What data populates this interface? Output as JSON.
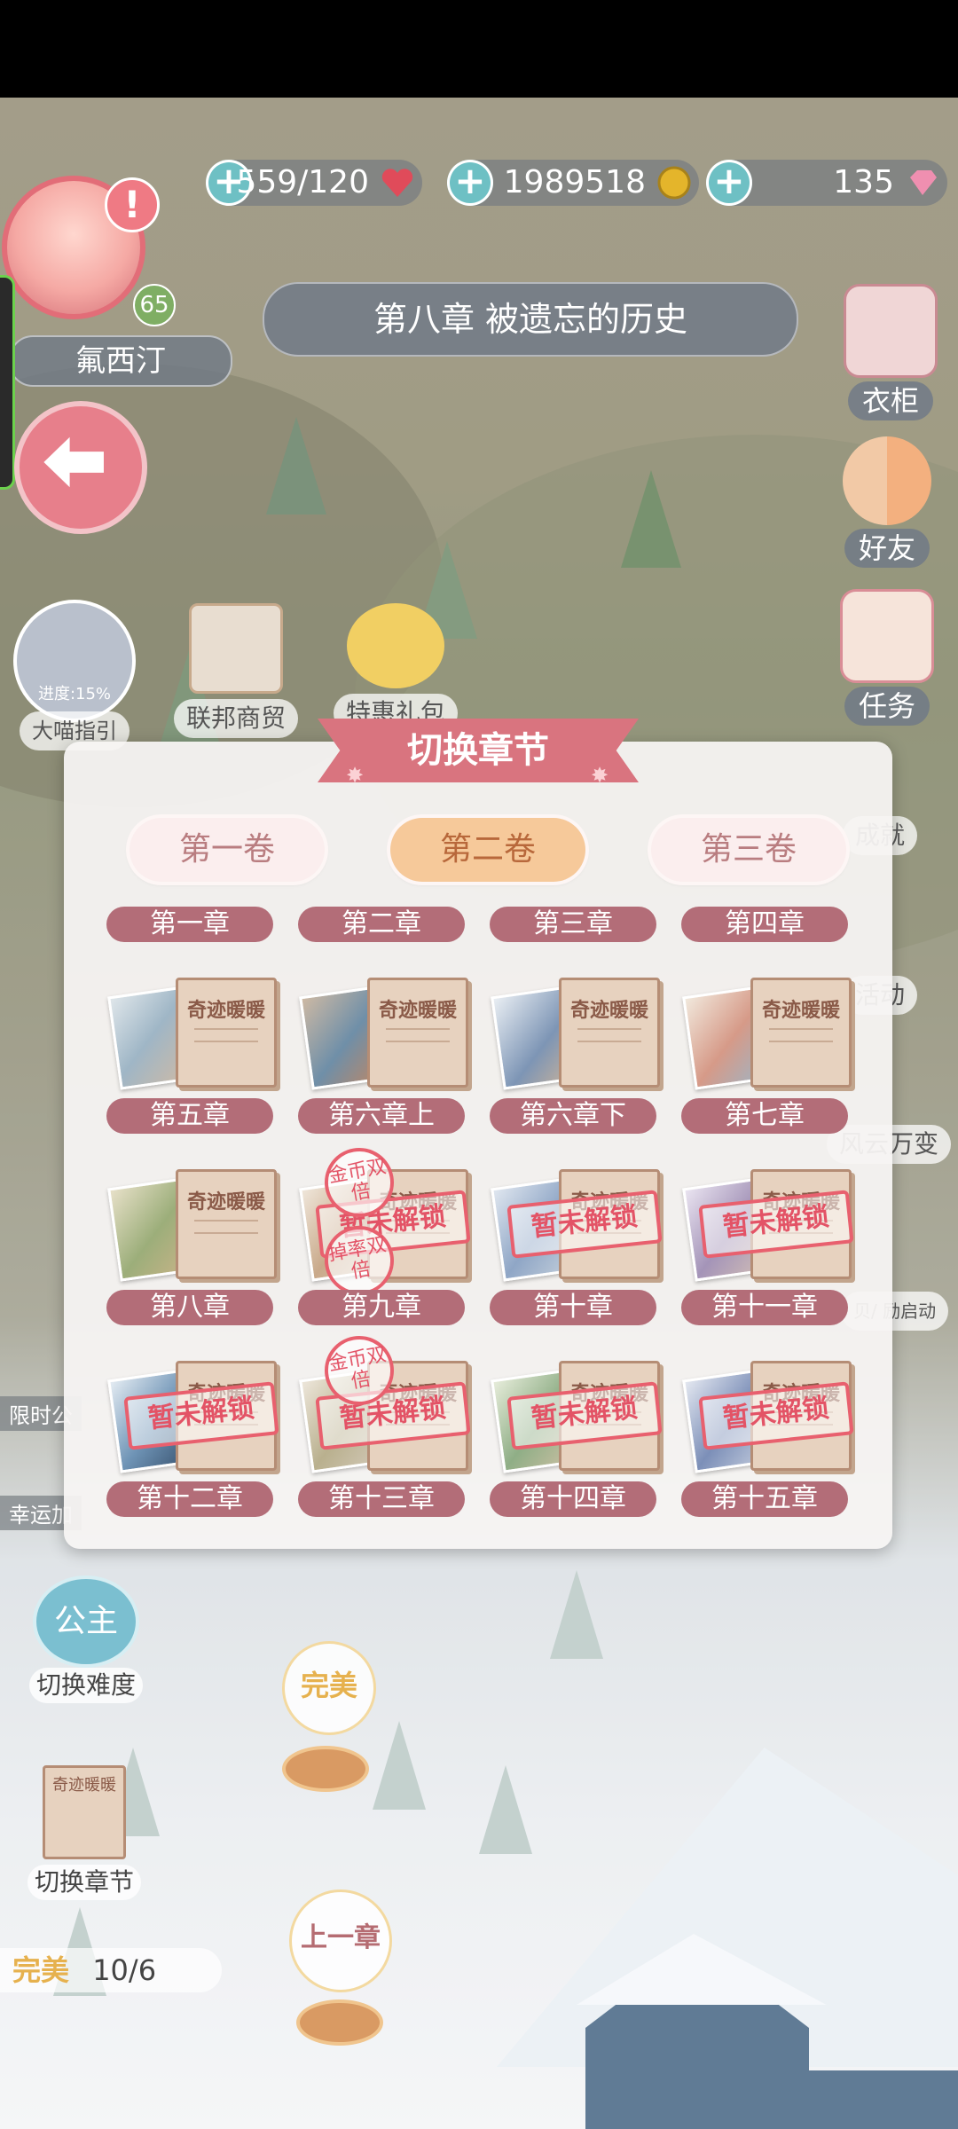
{
  "resources": {
    "stamina": "559/120",
    "gold": "1989518",
    "diamonds": "135"
  },
  "player": {
    "name": "氟西汀",
    "level": "65",
    "alert": "!"
  },
  "header": {
    "chapter_title": "第八章 被遗忘的历史"
  },
  "right_menu": {
    "wardrobe": "衣柜",
    "friends": "好友",
    "tasks": "任务",
    "achievements": "成就",
    "events": "活动",
    "fortune": "风云万变",
    "misc": "贝/ 励启动"
  },
  "left_menu": {
    "progress": "进度:15%",
    "guide": "大喵指引",
    "federation_shop": "联邦商贸",
    "special_pack": "特惠礼包",
    "limited": "限时公",
    "lucky": "幸运加",
    "difficulty_badge": "公主",
    "switch_difficulty": "切换难度",
    "switch_chapter": "切换章节",
    "book_mini_title": "奇迹暖暖"
  },
  "bottom": {
    "perfect_badge": "完美",
    "prev_chapter": "上一章",
    "perfect_label": "完美",
    "perfect_count": "10/6"
  },
  "modal": {
    "title": "切换章节",
    "volumes": [
      "第一卷",
      "第二卷",
      "第三卷"
    ],
    "active_volume_index": 1,
    "book_title": "奇迹暖暖",
    "locked_text": "暂未解锁",
    "stamp_gold_double": "金币双倍",
    "stamp_drop_double": "掉率双倍",
    "chapters": [
      {
        "label": "第一章"
      },
      {
        "label": "第二章"
      },
      {
        "label": "第三章"
      },
      {
        "label": "第四章"
      },
      {
        "label": "第五章",
        "locked": false
      },
      {
        "label": "第六章上",
        "locked": false
      },
      {
        "label": "第六章下",
        "locked": false
      },
      {
        "label": "第七章",
        "locked": false
      },
      {
        "label": "第八章",
        "locked": false
      },
      {
        "label": "第九章",
        "locked": true
      },
      {
        "label": "第十章",
        "locked": true
      },
      {
        "label": "第十一章",
        "locked": true
      },
      {
        "label": "第十二章",
        "locked": true
      },
      {
        "label": "第十三章",
        "locked": true
      },
      {
        "label": "第十四章",
        "locked": true
      },
      {
        "label": "第十五章",
        "locked": true
      }
    ]
  },
  "colors": {
    "accent_pink": "#d9747f",
    "chapter_label": "#b36d78",
    "active_tab": "#f6c99a",
    "stamp_red": "#e8606e"
  }
}
